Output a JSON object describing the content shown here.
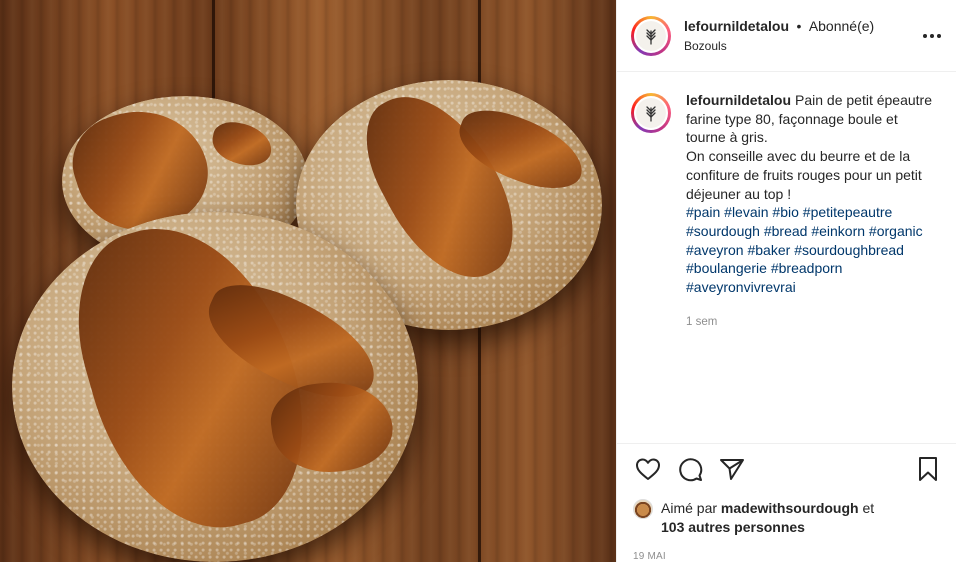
{
  "post": {
    "image_description_name": "bread-photo",
    "header": {
      "username": "lefournildetalou",
      "separator": "•",
      "follow_status": "Abonné(e)",
      "location": "Bozouls",
      "more_icon": "more-horizontal-icon"
    },
    "caption": {
      "username": "lefournildetalou",
      "text_line1": "Pain de petit épeautre farine type 80, façonnage boule et tourne à gris.",
      "text_line2": "On conseille avec du beurre et de la confiture de fruits rouges pour un petit déjeuner au top !",
      "hashtags": [
        "#pain",
        "#levain",
        "#bio",
        "#petitepeautre",
        "#sourdough",
        "#bread",
        "#einkorn",
        "#organic",
        "#aveyron",
        "#baker",
        "#sourdoughbread",
        "#boulangerie",
        "#breadporn",
        "#aveyronvivrevrai"
      ],
      "time": "1 sem"
    },
    "actions": {
      "like_icon": "heart-icon",
      "comment_icon": "comment-icon",
      "share_icon": "paper-plane-icon",
      "save_icon": "bookmark-icon"
    },
    "likes": {
      "prefix": "Aimé par",
      "liker": "madewithsourdough",
      "conjunction": "et",
      "others": "103 autres personnes"
    },
    "date": "19 MAI"
  }
}
